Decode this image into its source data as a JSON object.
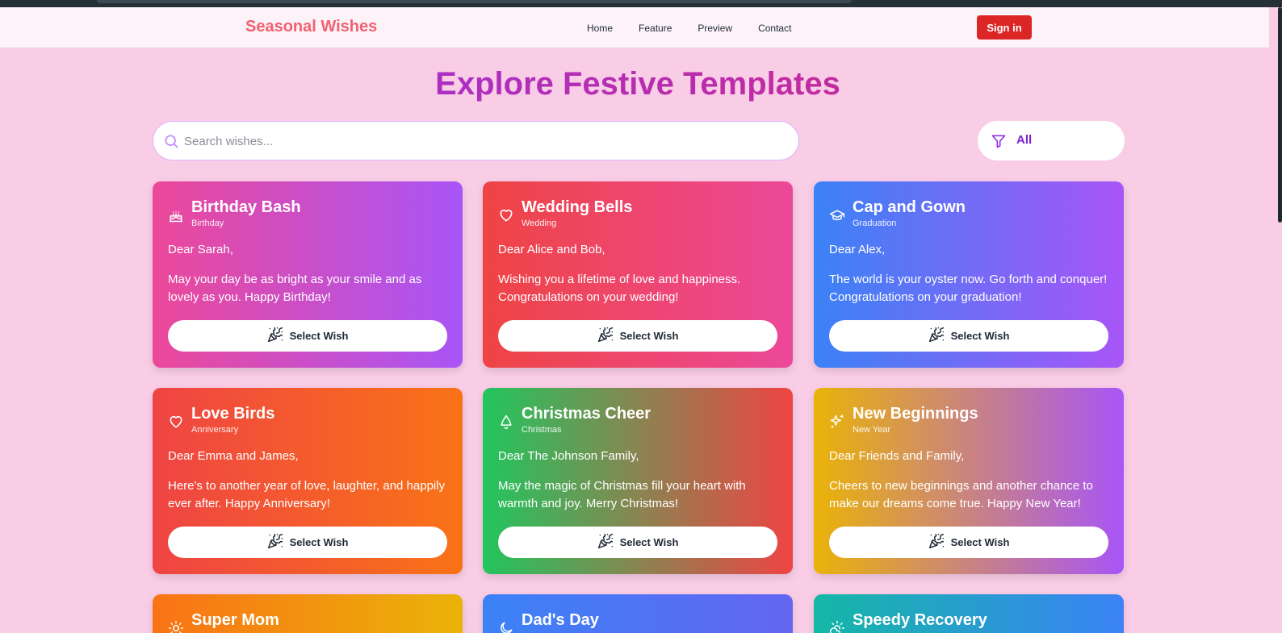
{
  "nav": {
    "brand": "Seasonal Wishes",
    "links": [
      "Home",
      "Feature",
      "Preview",
      "Contact"
    ],
    "signin": "Sign in"
  },
  "page": {
    "title": "Explore Festive Templates",
    "search_placeholder": "Search wishes...",
    "filter_value": "All"
  },
  "cards": [
    {
      "title": "Birthday Bash",
      "category": "Birthday",
      "greeting": "Dear Sarah,",
      "message": "May your day be as bright as your smile and as lovely as you. Happy Birthday!",
      "button": "Select Wish",
      "icon": "cake-icon",
      "gradient": [
        "#ec4899",
        "#a855f7"
      ]
    },
    {
      "title": "Wedding Bells",
      "category": "Wedding",
      "greeting": "Dear Alice and Bob,",
      "message": "Wishing you a lifetime of love and happiness. Congratulations on your wedding!",
      "button": "Select Wish",
      "icon": "heart-icon",
      "gradient": [
        "#ef4444",
        "#ec4899"
      ]
    },
    {
      "title": "Cap and Gown",
      "category": "Graduation",
      "greeting": "Dear Alex,",
      "message": "The world is your oyster now. Go forth and conquer! Congratulations on your graduation!",
      "button": "Select Wish",
      "icon": "graduation-cap-icon",
      "gradient": [
        "#3b82f6",
        "#a855f7"
      ]
    },
    {
      "title": "Love Birds",
      "category": "Anniversary",
      "greeting": "Dear Emma and James,",
      "message": "Here's to another year of love, laughter, and happily ever after. Happy Anniversary!",
      "button": "Select Wish",
      "icon": "heart-icon",
      "gradient": [
        "#ef4444",
        "#f97316"
      ]
    },
    {
      "title": "Christmas Cheer",
      "category": "Christmas",
      "greeting": "Dear The Johnson Family,",
      "message": "May the magic of Christmas fill your heart with warmth and joy. Merry Christmas!",
      "button": "Select Wish",
      "icon": "bell-icon",
      "gradient": [
        "#22c55e",
        "#ef4444"
      ]
    },
    {
      "title": "New Beginnings",
      "category": "New Year",
      "greeting": "Dear Friends and Family,",
      "message": "Cheers to new beginnings and another chance to make our dreams come true. Happy New Year!",
      "button": "Select Wish",
      "icon": "sparkles-icon",
      "gradient": [
        "#eab308",
        "#a855f7"
      ]
    },
    {
      "title": "Super Mom",
      "icon": "sun-icon",
      "gradient": [
        "#f97316",
        "#eab308"
      ]
    },
    {
      "title": "Dad's Day",
      "icon": "moon-icon",
      "gradient": [
        "#3b82f6",
        "#6366f1"
      ]
    },
    {
      "title": "Speedy Recovery",
      "icon": "cloud-sun-icon",
      "gradient": [
        "#14b8a6",
        "#3b82f6"
      ]
    }
  ]
}
